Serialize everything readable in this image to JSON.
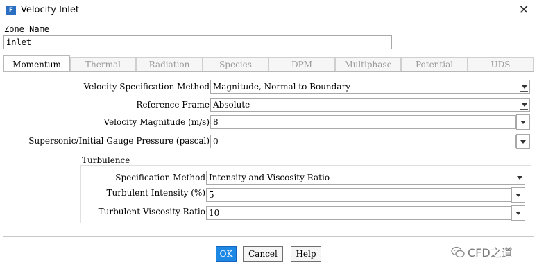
{
  "window": {
    "title": "Velocity Inlet",
    "app_icon_letter": "F",
    "close_glyph": "✕"
  },
  "zone": {
    "label": "Zone Name",
    "value": "inlet"
  },
  "tabs": [
    {
      "label": "Momentum",
      "active": true
    },
    {
      "label": "Thermal",
      "active": false
    },
    {
      "label": "Radiation",
      "active": false
    },
    {
      "label": "Species",
      "active": false
    },
    {
      "label": "DPM",
      "active": false
    },
    {
      "label": "Multiphase",
      "active": false
    },
    {
      "label": "Potential",
      "active": false
    },
    {
      "label": "UDS",
      "active": false
    }
  ],
  "momentum": {
    "velocity_spec_method": {
      "label": "Velocity Specification Method",
      "value": "Magnitude, Normal to Boundary"
    },
    "reference_frame": {
      "label": "Reference Frame",
      "value": "Absolute"
    },
    "velocity_magnitude": {
      "label": "Velocity Magnitude (m/s)",
      "value": "8"
    },
    "gauge_pressure": {
      "label": "Supersonic/Initial Gauge Pressure (pascal)",
      "value": "0"
    }
  },
  "turbulence": {
    "title": "Turbulence",
    "spec_method": {
      "label": "Specification Method",
      "value": "Intensity and Viscosity Ratio"
    },
    "intensity": {
      "label": "Turbulent Intensity (%)",
      "value": "5"
    },
    "viscosity_ratio": {
      "label": "Turbulent Viscosity Ratio",
      "value": "10"
    }
  },
  "buttons": {
    "ok": "OK",
    "cancel": "Cancel",
    "help": "Help"
  },
  "watermark": {
    "text": "CFD之道"
  },
  "colors": {
    "accent": "#1e88e5",
    "app_icon": "#2b6fc2"
  }
}
